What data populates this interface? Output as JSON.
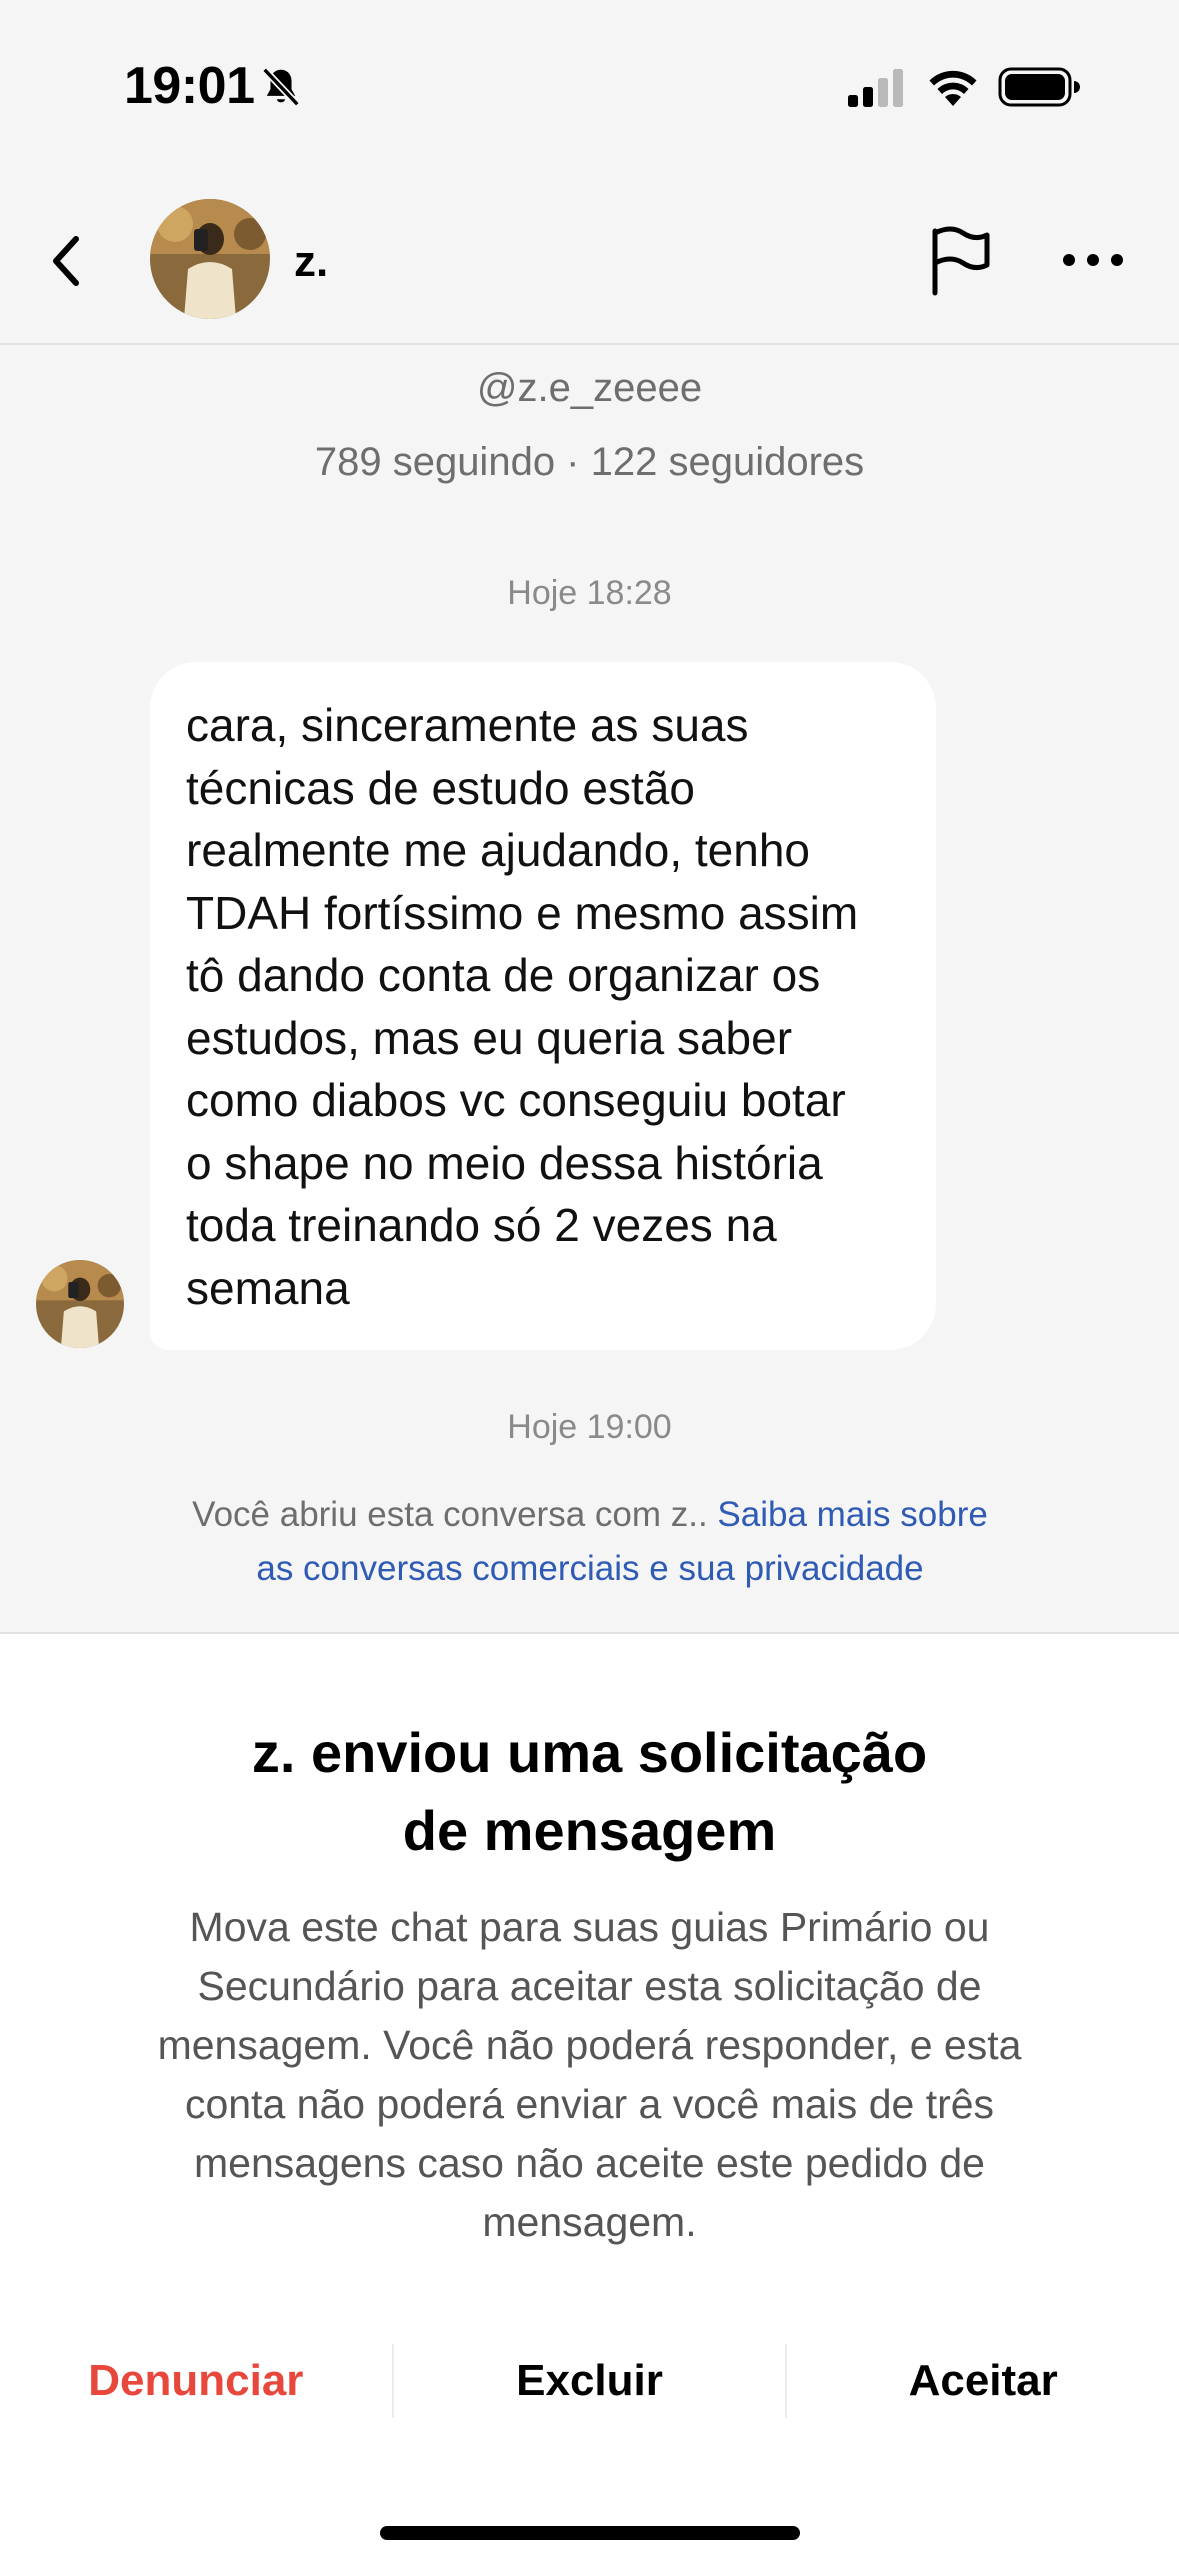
{
  "status_bar": {
    "time": "19:01",
    "icons": [
      "bell-slash-icon",
      "cellular-signal-icon",
      "wifi-icon",
      "battery-icon"
    ]
  },
  "header": {
    "name": "z.",
    "icons": [
      "back-chevron-icon",
      "flag-icon",
      "more-icon"
    ]
  },
  "profile": {
    "handle": "@z.e_zeeee",
    "stats": "789 seguindo · 122 seguidores"
  },
  "conversation": {
    "timestamp_1": "Hoje 18:28",
    "message_lines": [
      "cara, sinceramente as suas",
      "técnicas de estudo estão",
      "realmente me ajudando, tenho",
      "TDAH fortíssimo e mesmo assim",
      "tô dando conta de organizar os",
      "estudos, mas eu queria saber",
      "como diabos vc conseguiu botar",
      "o shape no meio dessa história",
      "toda treinando só 2 vezes na",
      "semana"
    ],
    "timestamp_2": "Hoje 19:00",
    "notice_text": "Você abriu esta conversa com z.. ",
    "notice_link_1": "Saiba mais sobre",
    "notice_link_2": "as conversas comerciais e sua privacidade"
  },
  "request": {
    "title_line_1": "z. enviou uma solicitação",
    "title_line_2": "de mensagem",
    "body_lines": [
      "Mova este chat para suas guias Primário ou",
      "Secundário para aceitar esta solicitação de",
      "mensagem. Você não poderá responder, e esta",
      "conta não poderá enviar a você mais de três",
      "mensagens caso não aceite este pedido de",
      "mensagem."
    ],
    "report_label": "Denunciar",
    "delete_label": "Excluir",
    "accept_label": "Aceitar"
  },
  "colors": {
    "background": "#f5f5f5",
    "danger": "#e8473b",
    "link": "#2f5bb5",
    "muted_text": "#6e6e6e"
  }
}
